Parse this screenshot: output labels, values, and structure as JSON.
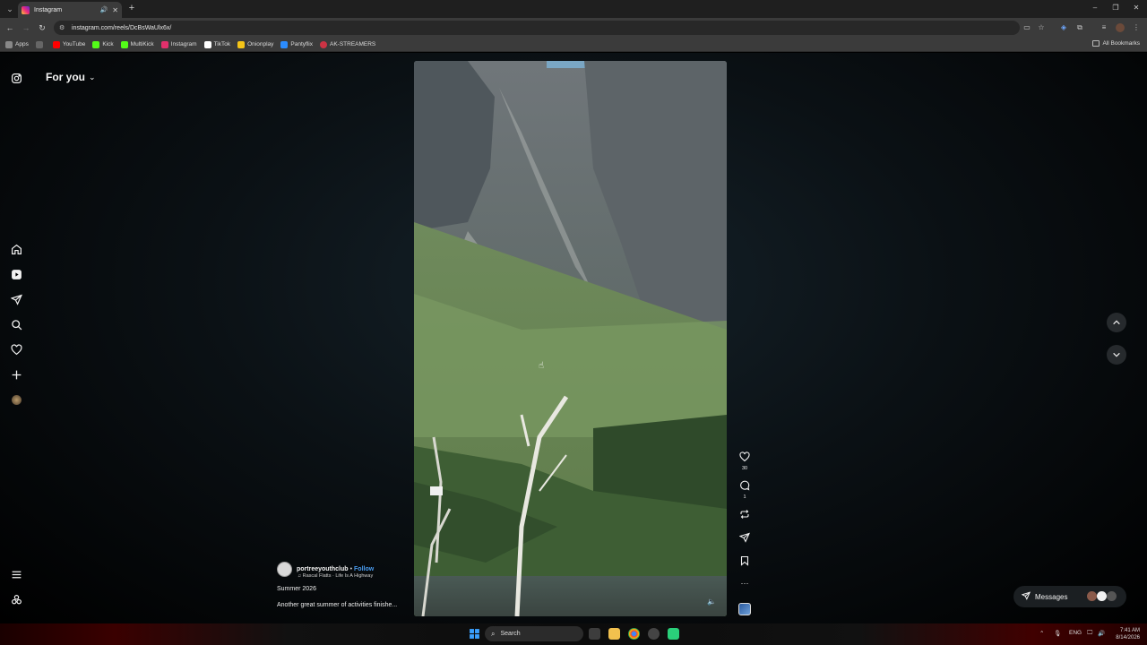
{
  "browser": {
    "tab_title": "Instagram",
    "url": "instagram.com/reels/DcBsWaUlx6x/",
    "bookmarks": [
      {
        "label": "Apps",
        "color": "#888888"
      },
      {
        "label": "YouTube",
        "color": "#ff0000"
      },
      {
        "label": "Kick",
        "color": "#53fc18"
      },
      {
        "label": "MultiKick",
        "color": "#53fc18"
      },
      {
        "label": "Instagram",
        "color": "#e1306c"
      },
      {
        "label": "TikTok",
        "color": "#ffffff"
      },
      {
        "label": "Onionplay",
        "color": "#f5c518"
      },
      {
        "label": "Pantyflix",
        "color": "#2b8cff"
      },
      {
        "label": "AK-STREAMERS",
        "color": "#cc3344"
      }
    ],
    "all_bookmarks": "All Bookmarks"
  },
  "app": {
    "feed_label": "For you"
  },
  "reel": {
    "author": "portreeyouthclub",
    "follow_label": "Follow",
    "music": "Rascal Flatts · Life Is A Highway",
    "title": "Summer 2026",
    "description": "Another great summer of activities finishe...",
    "likes": "30",
    "comments": "1"
  },
  "messages": {
    "label": "Messages"
  },
  "taskbar": {
    "search_placeholder": "Search",
    "language": "ENG",
    "time": "7:41 AM",
    "date": "8/14/2026"
  },
  "colors": {
    "accent": "#4a9cf0",
    "background": "#000000"
  }
}
